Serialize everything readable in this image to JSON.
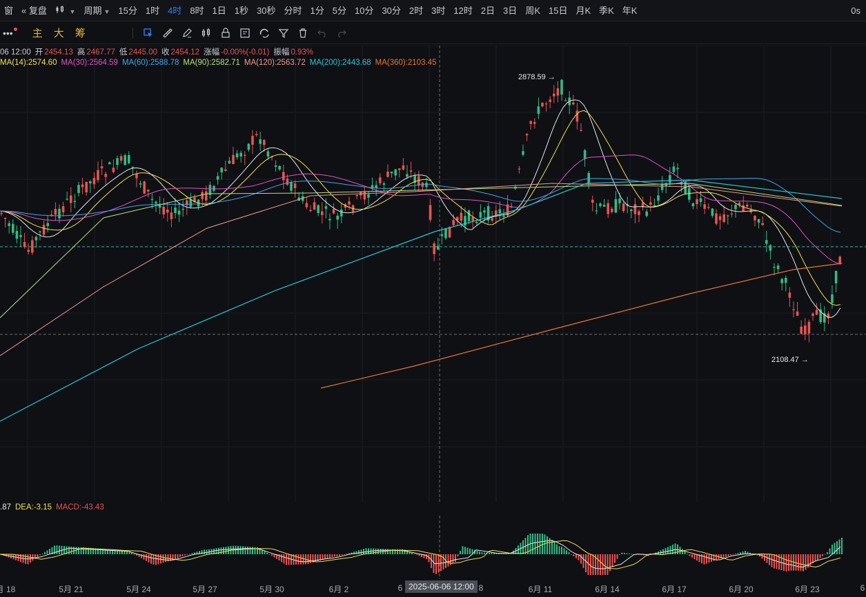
{
  "topbar": {
    "window_label": "窗",
    "restore_label": "复盘",
    "chart_type_icon": "candlestick-icon",
    "period_label": "周期",
    "periods": [
      "15分",
      "1时",
      "4时",
      "8时",
      "1日",
      "1秒",
      "30秒",
      "分时",
      "1分",
      "5分",
      "10分",
      "30分",
      "2时",
      "3时",
      "12时",
      "2日",
      "3日",
      "周K",
      "15日",
      "月K",
      "季K",
      "年K"
    ],
    "active_period": "4时",
    "countdown": "0s"
  },
  "toolbar2": {
    "labels": [
      "主",
      "大",
      "筹"
    ],
    "tools": [
      "select-icon",
      "ruler-icon",
      "pen-icon",
      "candle-bars-icon",
      "lock-icon",
      "note-icon",
      "magnet-icon",
      "filter-icon",
      "trash-icon",
      "undo-icon",
      "redo-icon"
    ]
  },
  "ohlc": {
    "time": "06 12:00",
    "open_label": "开",
    "open": "2454.13",
    "high_label": "高",
    "high": "2467.77",
    "low_label": "低",
    "low": "2445.00",
    "close_label": "收",
    "close": "2454.12",
    "change_label": "涨幅",
    "change": "-0.00%(-0.01)",
    "amp_label": "振幅",
    "amp": "0.93%"
  },
  "ma": [
    {
      "text": "MA(14):2574.60",
      "color": "#f0e24c"
    },
    {
      "text": "MA(30):2564.59",
      "color": "#e052c7"
    },
    {
      "text": "MA(60):2588.78",
      "color": "#3fa7ea"
    },
    {
      "text": "MA(90):2582.71",
      "color": "#b6e27a"
    },
    {
      "text": "MA(120):2563.72",
      "color": "#f19b8e"
    },
    {
      "text": "MA(200):2443.68",
      "color": "#25c9d8"
    },
    {
      "text": "MA(360):2103.45",
      "color": "#e8782a"
    }
  ],
  "macd": {
    "dif": ".87",
    "dea": "DEA:-3.15",
    "macd": "MACD:-43.43"
  },
  "price_marks": {
    "high": "2878.59",
    "low": "2108.47"
  },
  "xaxis": [
    "月 18",
    "5月 21",
    "5月 24",
    "5月 27",
    "5月 30",
    "6月 2",
    "6",
    "8",
    "6月 11",
    "6月 14",
    "6月 17",
    "6月 20",
    "6月 23",
    "6"
  ],
  "cursor_date": "2025-06-06 12:00",
  "colors": {
    "up": "#2ebd85",
    "down": "#e8544f",
    "accent": "#2f7cf6"
  }
}
